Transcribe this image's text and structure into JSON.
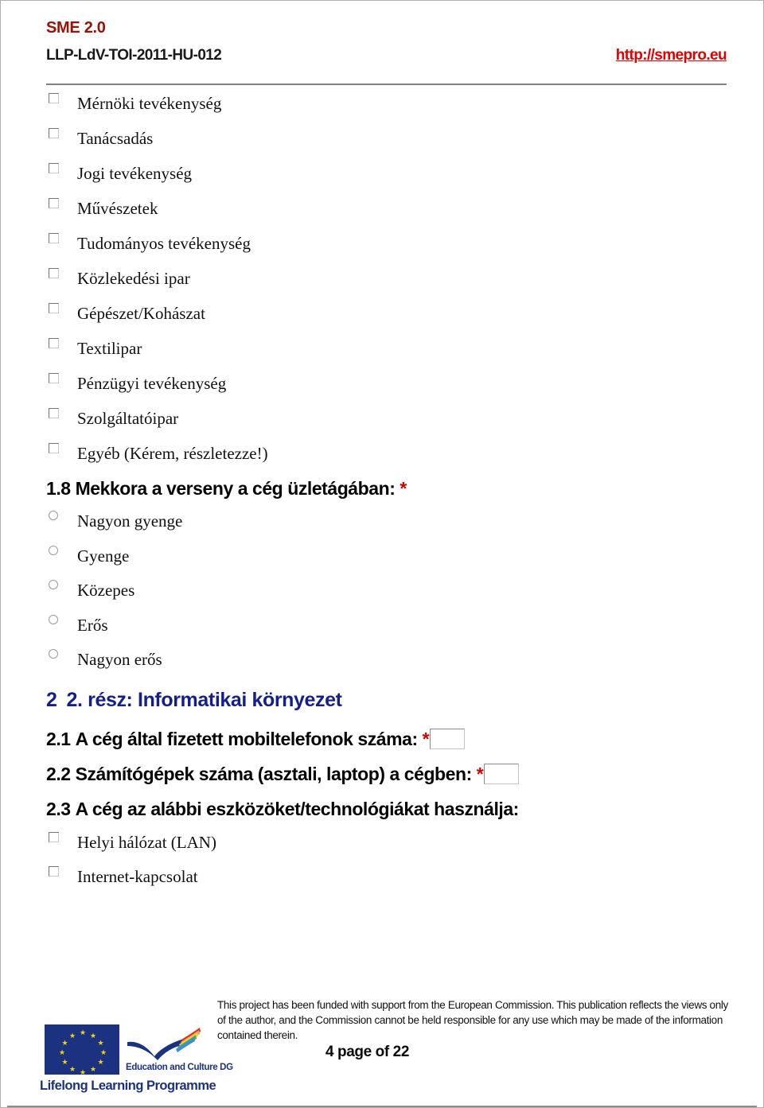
{
  "header": {
    "project_title": "SME 2.0",
    "project_code": "LLP-LdV-TOI-2011-HU-012",
    "url": "http://smepro.eu",
    "title_color": "#9c1006",
    "url_color": "#e00000"
  },
  "sector_checkboxes": [
    {
      "label": "Mérnöki tevékenység",
      "checked": false
    },
    {
      "label": "Tanácsadás",
      "checked": false
    },
    {
      "label": "Jogi tevékenység",
      "checked": false
    },
    {
      "label": "Művészetek",
      "checked": false
    },
    {
      "label": "Tudományos tevékenység",
      "checked": false
    },
    {
      "label": "Közlekedési ipar",
      "checked": false
    },
    {
      "label": "Gépészet/Kohászat",
      "checked": false
    },
    {
      "label": "Textilipar",
      "checked": false
    },
    {
      "label": "Pénzügyi tevékenység",
      "checked": false
    },
    {
      "label": "Szolgáltatóipar",
      "checked": false
    },
    {
      "label": "Egyéb (Kérem, részletezze!)",
      "checked": false
    }
  ],
  "question_1_8": {
    "number": "1.8",
    "text": "Mekkora a verseny a cég üzletágában:",
    "required_mark": "*",
    "options": [
      {
        "label": "Nagyon gyenge",
        "selected": false
      },
      {
        "label": "Gyenge",
        "selected": false
      },
      {
        "label": "Közepes",
        "selected": false
      },
      {
        "label": "Erős",
        "selected": false
      },
      {
        "label": "Nagyon erős",
        "selected": false
      }
    ]
  },
  "section_2": {
    "number": "2",
    "title": "2. rész: Informatikai környezet",
    "color": "#141f8c"
  },
  "question_2_1": {
    "number": "2.1",
    "text": "A cég által fizetett mobiltelefonok száma:",
    "required_mark": "*",
    "value": "",
    "placeholder": ""
  },
  "question_2_2": {
    "number": "2.2",
    "text": "Számítógépek száma (asztali, laptop) a cégben:",
    "required_mark": "*",
    "value": "",
    "placeholder": ""
  },
  "question_2_3": {
    "number": "2.3",
    "text": "A cég az alábbi eszközöket/technológiákat használja:",
    "options": [
      {
        "label": "Helyi hálózat (LAN)",
        "checked": false
      },
      {
        "label": "Internet-kapcsolat",
        "checked": false
      }
    ]
  },
  "footer": {
    "logo": {
      "education_dg": "Education and Culture DG",
      "programme": "Lifelong Learning Programme",
      "flag_color": "#1b3281",
      "star_color": "#f7d117"
    },
    "disclaimer": "This project has been funded with support from the European Commission. This publication reflects the views only of the author, and the Commission cannot be held responsible for any use which may be made of the information contained therein.",
    "page_label": "4 page of 22"
  }
}
